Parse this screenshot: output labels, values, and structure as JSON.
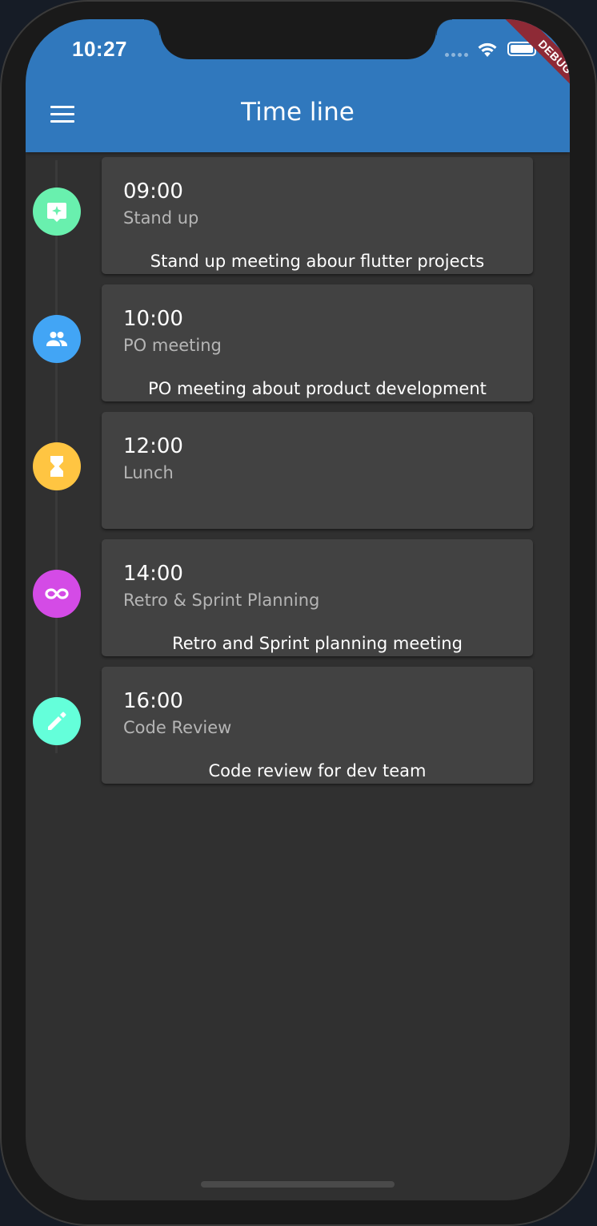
{
  "status_bar": {
    "time": "10:27",
    "debug_label": "DEBUG"
  },
  "app_bar": {
    "title": "Time line",
    "menu_icon": "menu-icon",
    "color": "#3078bd"
  },
  "timeline": {
    "items": [
      {
        "time": "09:00",
        "title": "Stand up",
        "description": "Stand up meeting abour flutter projects",
        "icon": "chat-sparkle-icon",
        "icon_color": "#69f0ae"
      },
      {
        "time": "10:00",
        "title": "PO meeting",
        "description": "PO meeting about product development",
        "icon": "people-icon",
        "icon_color": "#42a5f5"
      },
      {
        "time": "12:00",
        "title": "Lunch",
        "description": "",
        "icon": "hourglass-icon",
        "icon_color": "#ffc542"
      },
      {
        "time": "14:00",
        "title": "Retro & Sprint Planning",
        "description": "Retro and Sprint planning meeting",
        "icon": "infinity-icon",
        "icon_color": "#d44be6"
      },
      {
        "time": "16:00",
        "title": "Code Review",
        "description": "Code review for dev team",
        "icon": "pencil-icon",
        "icon_color": "#64ffda"
      }
    ]
  }
}
